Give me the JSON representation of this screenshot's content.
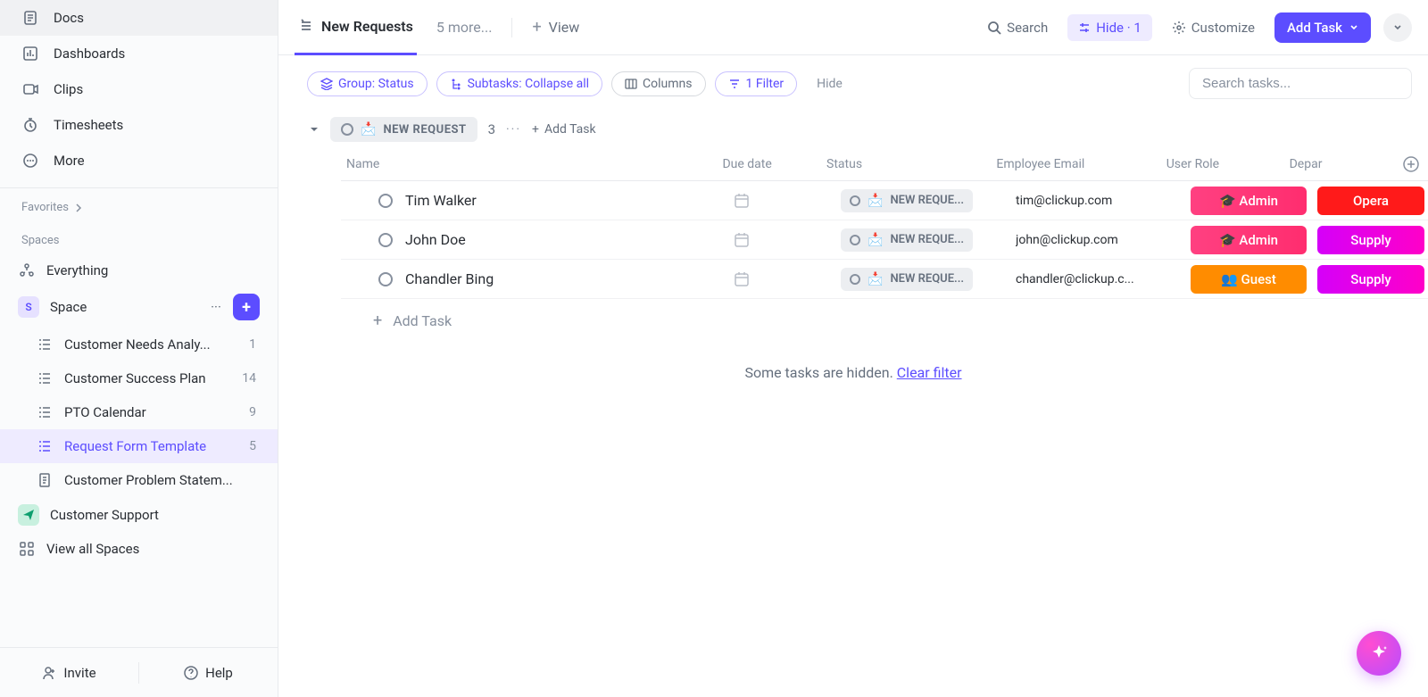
{
  "sidebar": {
    "nav": [
      {
        "icon": "doc",
        "label": "Docs"
      },
      {
        "icon": "dashboard",
        "label": "Dashboards"
      },
      {
        "icon": "clip",
        "label": "Clips"
      },
      {
        "icon": "timesheet",
        "label": "Timesheets"
      },
      {
        "icon": "more",
        "label": "More"
      }
    ],
    "favorites_label": "Favorites",
    "spaces_label": "Spaces",
    "everything_label": "Everything",
    "space": {
      "letter": "S",
      "name": "Space"
    },
    "lists": [
      {
        "label": "Customer Needs Analy...",
        "count": "1",
        "active": false,
        "icon": "list"
      },
      {
        "label": "Customer Success Plan",
        "count": "14",
        "active": false,
        "icon": "list"
      },
      {
        "label": "PTO Calendar",
        "count": "9",
        "active": false,
        "icon": "list"
      },
      {
        "label": "Request Form Template",
        "count": "5",
        "active": true,
        "icon": "list"
      },
      {
        "label": "Customer Problem Statem...",
        "count": "",
        "active": false,
        "icon": "doc"
      }
    ],
    "support": {
      "label": "Customer Support"
    },
    "view_all_label": "View all Spaces",
    "invite_label": "Invite",
    "help_label": "Help"
  },
  "toolbar": {
    "active_tab": "New Requests",
    "more_tabs": "5 more...",
    "view_label": "View",
    "search_label": "Search",
    "hide_label": "Hide · 1",
    "customize_label": "Customize",
    "add_task_label": "Add Task"
  },
  "filterbar": {
    "group": "Group: Status",
    "subtasks": "Subtasks: Collapse all",
    "columns": "Columns",
    "filter": "1 Filter",
    "hide": "Hide",
    "search_placeholder": "Search tasks..."
  },
  "group": {
    "status_label": "NEW REQUEST",
    "status_emoji": "📩",
    "count": "3",
    "add_task": "Add Task"
  },
  "columns": {
    "name": "Name",
    "due": "Due date",
    "status": "Status",
    "email": "Employee Email",
    "role": "User Role",
    "dept": "Depar"
  },
  "rows": [
    {
      "name": "Tim Walker",
      "status": "NEW REQUE...",
      "email": "tim@clickup.com",
      "role": "🎓 Admin",
      "role_class": "admin",
      "dept": "Opera",
      "dept_class": "oper"
    },
    {
      "name": "John Doe",
      "status": "NEW REQUE...",
      "email": "john@clickup.com",
      "role": "🎓 Admin",
      "role_class": "admin",
      "dept": "Supply",
      "dept_class": "supply"
    },
    {
      "name": "Chandler Bing",
      "status": "NEW REQUE...",
      "email": "chandler@clickup.c...",
      "role": "👥 Guest",
      "role_class": "guest",
      "dept": "Supply",
      "dept_class": "supply"
    }
  ],
  "add_row_label": "Add Task",
  "hidden_msg": {
    "text": "Some tasks are hidden. ",
    "link": "Clear filter"
  }
}
